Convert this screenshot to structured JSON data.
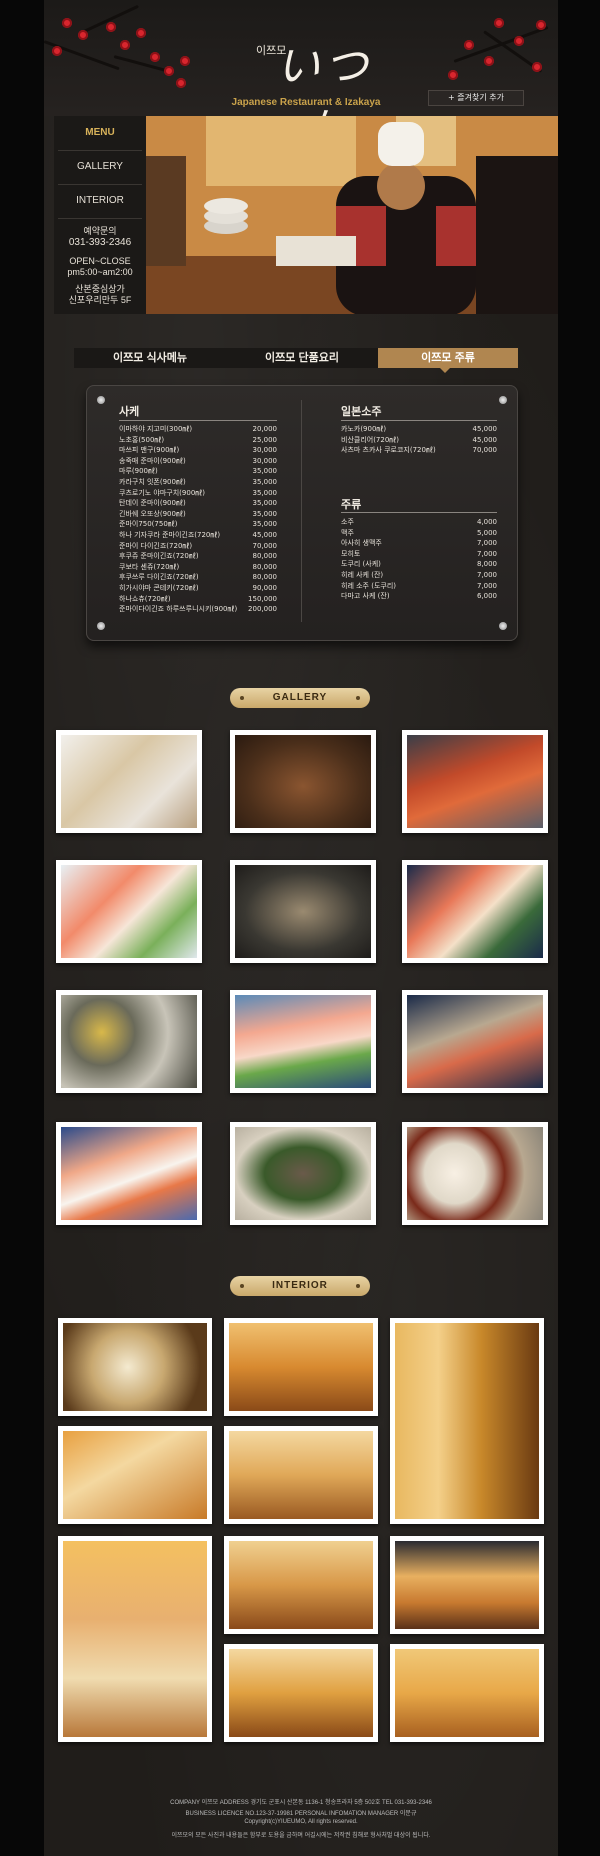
{
  "header": {
    "logo_kr": "이쯔모",
    "logo_main": "いつも",
    "tagline": "Japanese Restaurant & Izakaya",
    "bookmark_label": "+ 즐겨찾기 추가"
  },
  "nav": {
    "menu": "MENU",
    "gallery": "GALLERY",
    "interior": "INTERIOR"
  },
  "info": {
    "reserve_label": "예약문의",
    "phone": "031-393-2346",
    "hours_label": "OPEN~CLOSE",
    "hours": "pm5:00~am2:00",
    "address_1": "산본중심상가",
    "address_2": "신포우리만두 5F"
  },
  "tabs": [
    "이쯔모 식사메뉴",
    "이쯔모 단품요리",
    "이쯔모 주류"
  ],
  "menu_board": {
    "sake": {
      "title": "사케",
      "items": [
        {
          "name": "이마하야 지고미(300㎖)",
          "price": "20,000"
        },
        {
          "name": "노초홍(500㎖)",
          "price": "25,000"
        },
        {
          "name": "마쓰피 맨구(900㎖)",
          "price": "30,000"
        },
        {
          "name": "송죽매 준마이(900㎖)",
          "price": "30,000"
        },
        {
          "name": "마루(900㎖)",
          "price": "35,000"
        },
        {
          "name": "카라구치 잇폰(900㎖)",
          "price": "35,000"
        },
        {
          "name": "쿠츠로기노 야마구치(900㎖)",
          "price": "35,000"
        },
        {
          "name": "탄데이 준마이(900㎖)",
          "price": "35,000"
        },
        {
          "name": "긴바쉐 오또상(900㎖)",
          "price": "35,000"
        },
        {
          "name": "준마이750(750㎖)",
          "price": "35,000"
        },
        {
          "name": "하나 기자쿠라 준마이긴죠(720㎖)",
          "price": "45,000"
        },
        {
          "name": "준마이 다이긴죠(720㎖)",
          "price": "70,000"
        },
        {
          "name": "후쿠쥬 준마이긴죠(720㎖)",
          "price": "80,000"
        },
        {
          "name": "쿠보타 센쥬(720㎖)",
          "price": "80,000"
        },
        {
          "name": "후쿠쓰루 다이긴죠(720㎖)",
          "price": "80,000"
        },
        {
          "name": "히가시야마 콘테키(720㎖)",
          "price": "90,000"
        },
        {
          "name": "하나쇼츄(720㎖)",
          "price": "150,000"
        },
        {
          "name": "준마이다이긴죠 하루쓰루니시키(900㎖)",
          "price": "200,000"
        }
      ]
    },
    "shochu": {
      "title": "일본소주",
      "items": [
        {
          "name": "카노카(900㎖)",
          "price": "45,000"
        },
        {
          "name": "비산클리어(720㎖)",
          "price": "45,000"
        },
        {
          "name": "사츠마 츠카사 쿠로코지(720㎖)",
          "price": "70,000"
        }
      ]
    },
    "liquor": {
      "title": "주류",
      "items": [
        {
          "name": "소주",
          "price": "4,000"
        },
        {
          "name": "맥주",
          "price": "5,000"
        },
        {
          "name": "아사히 생맥주",
          "price": "7,000"
        },
        {
          "name": "모히토",
          "price": "7,000"
        },
        {
          "name": "도쿠리 (사케)",
          "price": "8,000"
        },
        {
          "name": "히레 사케 (잔)",
          "price": "7,000"
        },
        {
          "name": "히레 소주 (도쿠리)",
          "price": "7,000"
        },
        {
          "name": "다마고 사케 (잔)",
          "price": "6,000"
        }
      ]
    }
  },
  "gallery_label": "GALLERY",
  "interior_label": "INTERIOR",
  "footer": {
    "line1": "COMPANY 이쯔모  ADDRESS 경기도 군포시 산본동 1136-1 청송프라자 5층 502호 TEL 031-393-2346",
    "line2": "BUSINESS LICENCE NO.123-37-19981  PERSONAL INFOMATION MANAGER 이문규",
    "line3": "Copyright(c)YIUEUMO, All rights reserved.",
    "line4": "이쯔모의 모든 사진과 내용들은 함부로 도용을 금하며 어길시에는 저작권 침해로 형사처벌 대상이 됩니다."
  }
}
